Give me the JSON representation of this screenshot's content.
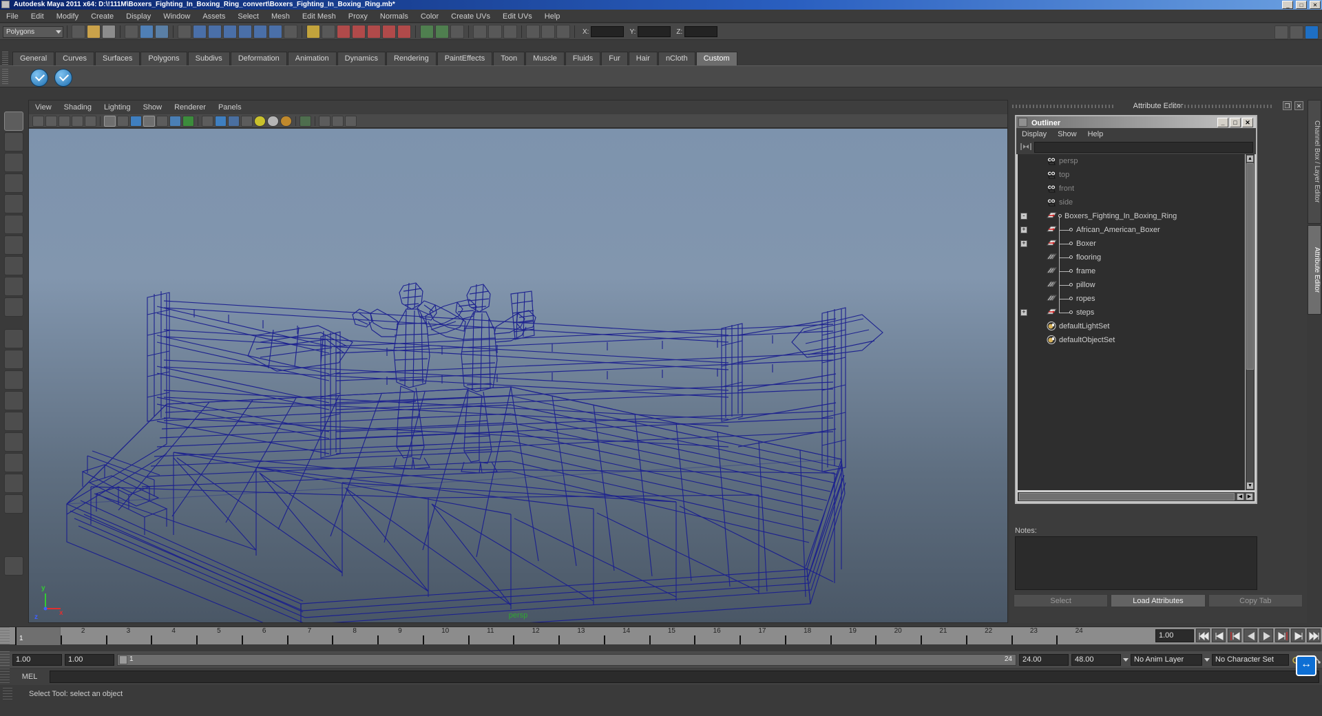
{
  "window": {
    "title": "Autodesk Maya 2011 x64: D:\\!111M\\Boxers_Fighting_In_Boxing_Ring_convert\\Boxers_Fighting_In_Boxing_Ring.mb*",
    "minimize": "_",
    "maximize": "□",
    "close": "✕"
  },
  "menubar": {
    "items": [
      "File",
      "Edit",
      "Modify",
      "Create",
      "Display",
      "Window",
      "Assets",
      "Select",
      "Mesh",
      "Edit Mesh",
      "Proxy",
      "Normals",
      "Color",
      "Create UVs",
      "Edit UVs",
      "Help"
    ]
  },
  "toolbar": {
    "menu_set": "Polygons",
    "axis_labels": [
      "X:",
      "Y:",
      "Z:"
    ],
    "axis_values": [
      "",
      "",
      ""
    ]
  },
  "shelf": {
    "tabs": [
      "General",
      "Curves",
      "Surfaces",
      "Polygons",
      "Subdivs",
      "Deformation",
      "Animation",
      "Dynamics",
      "Rendering",
      "PaintEffects",
      "Toon",
      "Muscle",
      "Fluids",
      "Fur",
      "Hair",
      "nCloth",
      "Custom"
    ],
    "active_tab": "Custom",
    "icon_count": 2,
    "icon_name": "checkmark-sphere-icon"
  },
  "viewport": {
    "menus": [
      "View",
      "Shading",
      "Lighting",
      "Show",
      "Renderer",
      "Panels"
    ],
    "camera_label": "persp",
    "axis_x": "x",
    "axis_y": "y",
    "axis_z": "z",
    "background_top": "#7d93ad",
    "background_bottom": "#4a5766",
    "wireframe_color": "#1b1f8f"
  },
  "attribute_editor": {
    "title": "Attribute Editor",
    "restore_glyph": "❐",
    "close_glyph": "✕",
    "notes_label": "Notes:",
    "notes_value": "",
    "buttons": [
      {
        "label": "Select",
        "enabled": false
      },
      {
        "label": "Load Attributes",
        "enabled": true
      },
      {
        "label": "Copy Tab",
        "enabled": false
      }
    ]
  },
  "outliner": {
    "title": "Outliner",
    "win_buttons": [
      "_",
      "□",
      "✕"
    ],
    "menus": [
      "Display",
      "Show",
      "Help"
    ],
    "search_value": "",
    "rows": [
      {
        "label": "persp",
        "icon": "camera-icon",
        "dim": true,
        "expand": null,
        "indent": 0,
        "child": false
      },
      {
        "label": "top",
        "icon": "camera-icon",
        "dim": true,
        "expand": null,
        "indent": 0,
        "child": false
      },
      {
        "label": "front",
        "icon": "camera-icon",
        "dim": true,
        "expand": null,
        "indent": 0,
        "child": false
      },
      {
        "label": "side",
        "icon": "camera-icon",
        "dim": true,
        "expand": null,
        "indent": 0,
        "child": false
      },
      {
        "label": "Boxers_Fighting_In_Boxing_Ring",
        "icon": "transform-icon",
        "dim": false,
        "expand": "-",
        "indent": 0,
        "child": false
      },
      {
        "label": "African_American_Boxer",
        "icon": "transform-icon",
        "dim": false,
        "expand": "+",
        "indent": 1,
        "child": true
      },
      {
        "label": "Boxer",
        "icon": "transform-icon",
        "dim": false,
        "expand": "+",
        "indent": 1,
        "child": true
      },
      {
        "label": "flooring",
        "icon": "mesh-icon",
        "dim": false,
        "expand": null,
        "indent": 1,
        "child": true
      },
      {
        "label": "frame",
        "icon": "mesh-icon",
        "dim": false,
        "expand": null,
        "indent": 1,
        "child": true
      },
      {
        "label": "pillow",
        "icon": "mesh-icon",
        "dim": false,
        "expand": null,
        "indent": 1,
        "child": true
      },
      {
        "label": "ropes",
        "icon": "mesh-icon",
        "dim": false,
        "expand": null,
        "indent": 1,
        "child": true
      },
      {
        "label": "steps",
        "icon": "transform-icon",
        "dim": false,
        "expand": "+",
        "indent": 1,
        "child": true
      },
      {
        "label": "defaultLightSet",
        "icon": "set-icon",
        "dim": false,
        "expand": null,
        "indent": 0,
        "child": false
      },
      {
        "label": "defaultObjectSet",
        "icon": "set-icon",
        "dim": false,
        "expand": null,
        "indent": 0,
        "child": false
      }
    ]
  },
  "side_tabs": [
    {
      "label": "Channel Box / Layer Editor",
      "active": false
    },
    {
      "label": "Attribute Editor",
      "active": true
    }
  ],
  "timeline": {
    "ticks": [
      "1",
      "2",
      "3",
      "4",
      "5",
      "6",
      "7",
      "8",
      "9",
      "10",
      "11",
      "12",
      "13",
      "14",
      "15",
      "16",
      "17",
      "18",
      "19",
      "20",
      "21",
      "22",
      "23",
      "24"
    ],
    "current_frame": "1",
    "current_frame_field": "1.00",
    "playback_buttons": [
      "go-to-start",
      "step-back-key",
      "step-back-frame",
      "play-backwards",
      "play-forwards",
      "step-forward-frame",
      "step-forward-key",
      "go-to-end"
    ]
  },
  "range": {
    "start_field": "1.00",
    "start2_field": "1.00",
    "slider_left": "1",
    "slider_right": "24",
    "end_field": "24.00",
    "end2_field": "48.00",
    "anim_layer": "No Anim Layer",
    "character_set": "No Character Set"
  },
  "command_line": {
    "language": "MEL",
    "value": ""
  },
  "status": {
    "text": "Select Tool: select an object"
  }
}
